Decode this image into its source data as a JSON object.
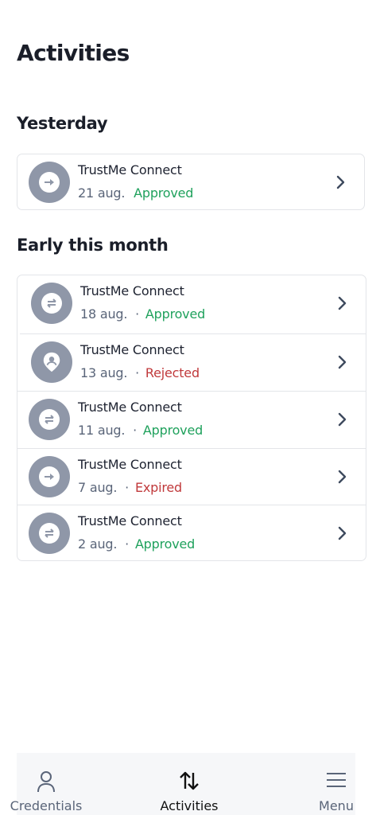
{
  "page": {
    "title": "Activities"
  },
  "sections": [
    {
      "heading": "Yesterday",
      "items": [
        {
          "name": "TrustMe Connect",
          "date": "21 aug.",
          "separator": "",
          "status": "Approved",
          "status_type": "approved",
          "icon": "arrow-right-icon"
        }
      ]
    },
    {
      "heading": "Early this month",
      "items": [
        {
          "name": "TrustMe Connect",
          "date": "18 aug.",
          "separator": "·",
          "status": "Approved",
          "status_type": "approved",
          "icon": "exchange-icon"
        },
        {
          "name": "TrustMe Connect",
          "date": "13 aug.",
          "separator": "·",
          "status": "Rejected",
          "status_type": "rejected",
          "icon": "location-person-icon"
        },
        {
          "name": "TrustMe Connect",
          "date": "11 aug.",
          "separator": "·",
          "status": "Approved",
          "status_type": "approved",
          "icon": "exchange-icon"
        },
        {
          "name": "TrustMe Connect",
          "date": "7 aug.",
          "separator": "·",
          "status": "Expired",
          "status_type": "expired",
          "icon": "arrow-right-icon"
        },
        {
          "name": "TrustMe Connect",
          "date": "2 aug.",
          "separator": "·",
          "status": "Approved",
          "status_type": "approved",
          "icon": "exchange-icon"
        }
      ]
    }
  ],
  "bottom_nav": [
    {
      "label": "Credentials",
      "icon": "person-icon",
      "active": false
    },
    {
      "label": "Activities",
      "icon": "up-down-arrows-icon",
      "active": true
    },
    {
      "label": "Menu",
      "icon": "hamburger-menu-icon",
      "active": false
    }
  ],
  "colors": {
    "approved": "#1fa15c",
    "rejected": "#c0393b",
    "expired": "#c0393b",
    "avatar_bg": "#8f97a8",
    "muted": "#5a6579"
  }
}
